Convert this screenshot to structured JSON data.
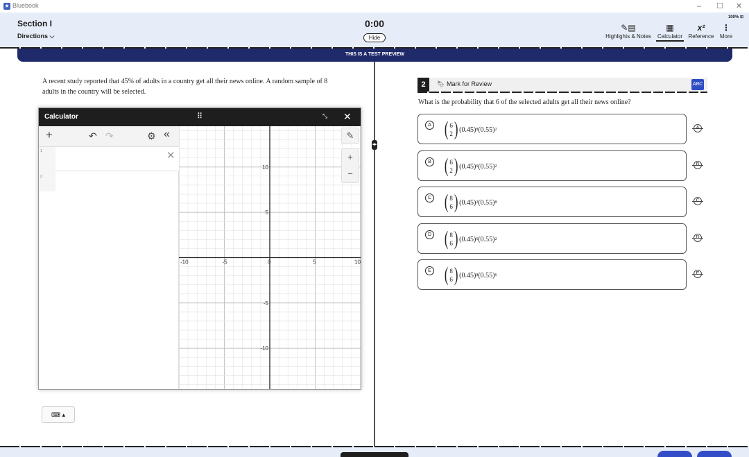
{
  "window": {
    "app_title": "Bluebook",
    "controls": {
      "minimize": "–",
      "maximize": "☐",
      "close": "✕"
    }
  },
  "header": {
    "section_title": "Section I",
    "directions_label": "Directions",
    "timer": "0:00",
    "hide_label": "Hide",
    "zoom": "100%",
    "tools": [
      {
        "label": "Highlights & Notes",
        "icon": "highlight-notes-icon",
        "glyph": "✎▤"
      },
      {
        "label": "Calculator",
        "icon": "calculator-icon",
        "glyph": "▦"
      },
      {
        "label": "Reference",
        "icon": "reference-icon",
        "glyph": "x²"
      },
      {
        "label": "More",
        "icon": "more-vertical-icon",
        "glyph": "⋮"
      }
    ]
  },
  "banner": {
    "text": "THIS IS A TEST PREVIEW"
  },
  "passage": {
    "text": "A recent study reported that 45% of adults in a country get all their news online. A random sample of 8 adults in the country will be selected."
  },
  "calculator": {
    "title": "Calculator",
    "drag_glyph": "⠿",
    "minimize_glyph": "⤡",
    "close_glyph": "✕",
    "toolbar": {
      "add": "+",
      "undo": "↶",
      "redo": "↷",
      "settings": "⚙",
      "collapse": "«"
    },
    "expressions": [
      {
        "num": "1"
      },
      {
        "num": "2"
      }
    ],
    "delete_glyph": "✕",
    "keyboard_glyph": "⌨ ▴",
    "graph_tools": {
      "wrench": "🔧",
      "zoom_in": "+",
      "zoom_out": "−"
    },
    "graph": {
      "xlim": [
        -10,
        10
      ],
      "ylim": [
        -14.5,
        14.5
      ],
      "x_ticks": [
        "-10",
        "-5",
        "0",
        "5",
        "10"
      ],
      "y_ticks": [
        "10",
        "5",
        "-5",
        "-10"
      ],
      "grid": true,
      "grid_color": "#e3e3e3",
      "major_color": "#bdbdbd",
      "axis_color": "#222222"
    }
  },
  "question": {
    "number": "2",
    "mark_label": "Mark for Review",
    "abc_label": "ABC",
    "prompt": "What is the probability that 6 of the selected adults get all their news online?",
    "choices": [
      {
        "letter": "A",
        "top": "6",
        "bottom": "2",
        "a": "(0.45)",
        "ae": "8",
        "b": "(0.55)",
        "be": "2"
      },
      {
        "letter": "B",
        "top": "6",
        "bottom": "2",
        "a": "(0.45)",
        "ae": "6",
        "b": "(0.55)",
        "be": "2"
      },
      {
        "letter": "C",
        "top": "8",
        "bottom": "6",
        "a": "(0.45)",
        "ae": "2",
        "b": "(0.55)",
        "be": "8"
      },
      {
        "letter": "D",
        "top": "8",
        "bottom": "6",
        "a": "(0.45)",
        "ae": "6",
        "b": "(0.55)",
        "be": "2"
      },
      {
        "letter": "E",
        "top": "8",
        "bottom": "6",
        "a": "(0.45)",
        "ae": "8",
        "b": "(0.55)",
        "be": "6"
      }
    ]
  },
  "colors": {
    "header_bg": "#e6edf8",
    "banner_bg": "#1f2a6b",
    "accent": "#324dc7"
  }
}
